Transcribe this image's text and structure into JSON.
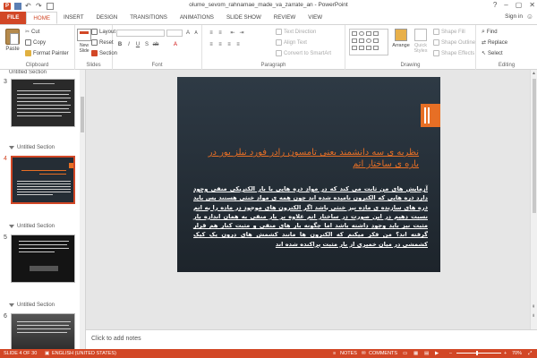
{
  "window": {
    "title": "olume_sevom_rahnamae_made_va_zarrate_an - PowerPoint",
    "help": "?",
    "minimize": "–",
    "restore": "▢",
    "close": "✕"
  },
  "tabs": [
    {
      "label": "FILE"
    },
    {
      "label": "HOME"
    },
    {
      "label": "INSERT"
    },
    {
      "label": "DESIGN"
    },
    {
      "label": "TRANSITIONS"
    },
    {
      "label": "ANIMATIONS"
    },
    {
      "label": "SLIDE SHOW"
    },
    {
      "label": "REVIEW"
    },
    {
      "label": "VIEW"
    }
  ],
  "signin": "Sign in",
  "ribbon": {
    "clipboard": {
      "label": "Clipboard",
      "paste": "Paste",
      "cut": "Cut",
      "copy": "Copy",
      "format_painter": "Format Painter"
    },
    "slides": {
      "label": "Slides",
      "new_slide": "New Slide",
      "layout": "Layout",
      "reset": "Reset",
      "section": "Section"
    },
    "font": {
      "label": "Font"
    },
    "paragraph": {
      "label": "Paragraph",
      "text_direction": "Text Direction",
      "align_text": "Align Text",
      "convert_smartart": "Convert to SmartArt"
    },
    "drawing": {
      "label": "Drawing",
      "arrange": "Arrange",
      "quick_styles": "Quick Styles",
      "shape_fill": "Shape Fill",
      "shape_outline": "Shape Outline",
      "shape_effects": "Shape Effects"
    },
    "editing": {
      "label": "Editing",
      "find": "Find",
      "replace": "Replace",
      "select": "Select"
    }
  },
  "thumbnails": {
    "sections": [
      {
        "label": "Untitled Section"
      },
      {
        "label": "Untitled Section"
      },
      {
        "label": "Untitled Section"
      },
      {
        "label": "Untitled Section"
      }
    ],
    "slides": [
      {
        "number": "3"
      },
      {
        "number": "4"
      },
      {
        "number": "5"
      },
      {
        "number": "6"
      }
    ]
  },
  "slide": {
    "title": "نظریه ی سه دانشمند یعنی تامسون رادر فورد نیلز بور در باره ی ساختار اتم",
    "body": "آزمایش های من ثابت می کند که در مواد ذره هایی با بار الکتریکی منفی وجود دارد ذره هایی که الکترون نامیده شده اند چون همه ی مواد خنثی هستند پس باید ذره های سازنده ی ماده نیز خنثی باشد اگر الکترون های موجود در ماده را به اتم نسبت دهیم در این صورت در ساختار اتم علاوه بر بار منفی به همان اندازه بار مثبت نیز باید وجود داشته باشد اما چگونه بار های منفی و مثبت کنار هم قرار گرفته اند؟ من فکر میکنم که الکترون ها مانند کشمش های درون یک کیک کشمشی در میان خمیری از بار مثبت پراکنده شده اند"
  },
  "notes": {
    "placeholder": "Click to add notes"
  },
  "status": {
    "slide": "SLIDE 4 OF 30",
    "language": "ENGLISH (UNITED STATES)",
    "notes": "NOTES",
    "comments": "COMMENTS",
    "zoom": "70%",
    "zoom_minus": "–",
    "zoom_plus": "+"
  }
}
